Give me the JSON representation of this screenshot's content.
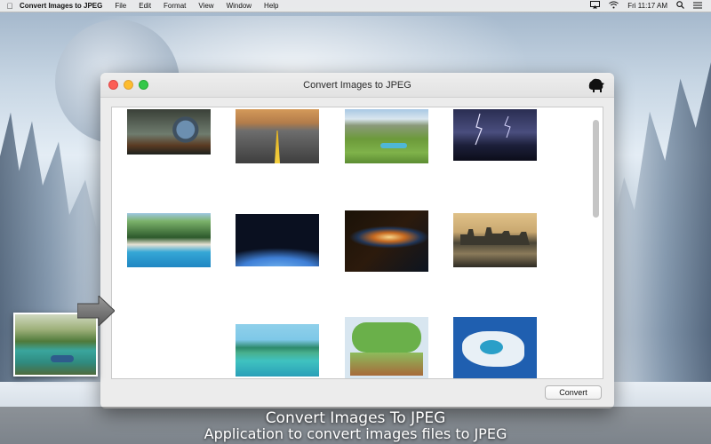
{
  "menubar": {
    "app_name": "Convert Images to JPEG",
    "menus": [
      "File",
      "Edit",
      "Format",
      "View",
      "Window",
      "Help"
    ],
    "clock": "Fri 11:17 AM"
  },
  "window": {
    "title": "Convert Images to JPEG",
    "convert_label": "Convert"
  },
  "thumbnails": [
    {
      "name": "thumb-earth-sphere",
      "colors": [
        "#2f3430",
        "#6f7c6e",
        "#1c211e"
      ]
    },
    {
      "name": "thumb-road-sunset",
      "colors": [
        "#c98a4c",
        "#5a5a5a",
        "#2a2a2a"
      ]
    },
    {
      "name": "thumb-green-valley",
      "colors": [
        "#9fc4e0",
        "#6c9a3a",
        "#7fb24a"
      ]
    },
    {
      "name": "thumb-lightning",
      "colors": [
        "#1c1f3a",
        "#4a4e7e",
        "#12142a"
      ]
    },
    {
      "name": "thumb-pool-palms",
      "colors": [
        "#7bb26a",
        "#2d5a2c",
        "#35a7d6"
      ]
    },
    {
      "name": "thumb-earth-space",
      "colors": [
        "#050608",
        "#0a1020",
        "#3f7fd6"
      ]
    },
    {
      "name": "thumb-nebula",
      "colors": [
        "#1a1208",
        "#c86a20",
        "#1f3d6a"
      ]
    },
    {
      "name": "thumb-city-skyline",
      "colors": [
        "#e0c188",
        "#4a4536",
        "#2d2a22"
      ]
    },
    {
      "name": "thumb-tropical-beach",
      "colors": [
        "#7ec8e8",
        "#2c8a6c",
        "#3fc2c0"
      ]
    },
    {
      "name": "thumb-trees-art",
      "colors": [
        "#d8e6f0",
        "#6ab04a",
        "#a66a3a"
      ]
    },
    {
      "name": "thumb-island-aerial",
      "colors": [
        "#1f5fb0",
        "#e8f0f6",
        "#2a9fc8"
      ]
    }
  ],
  "captions": {
    "line1": "Convert Images To JPEG",
    "line2": "Application to convert images files to JPEG"
  }
}
